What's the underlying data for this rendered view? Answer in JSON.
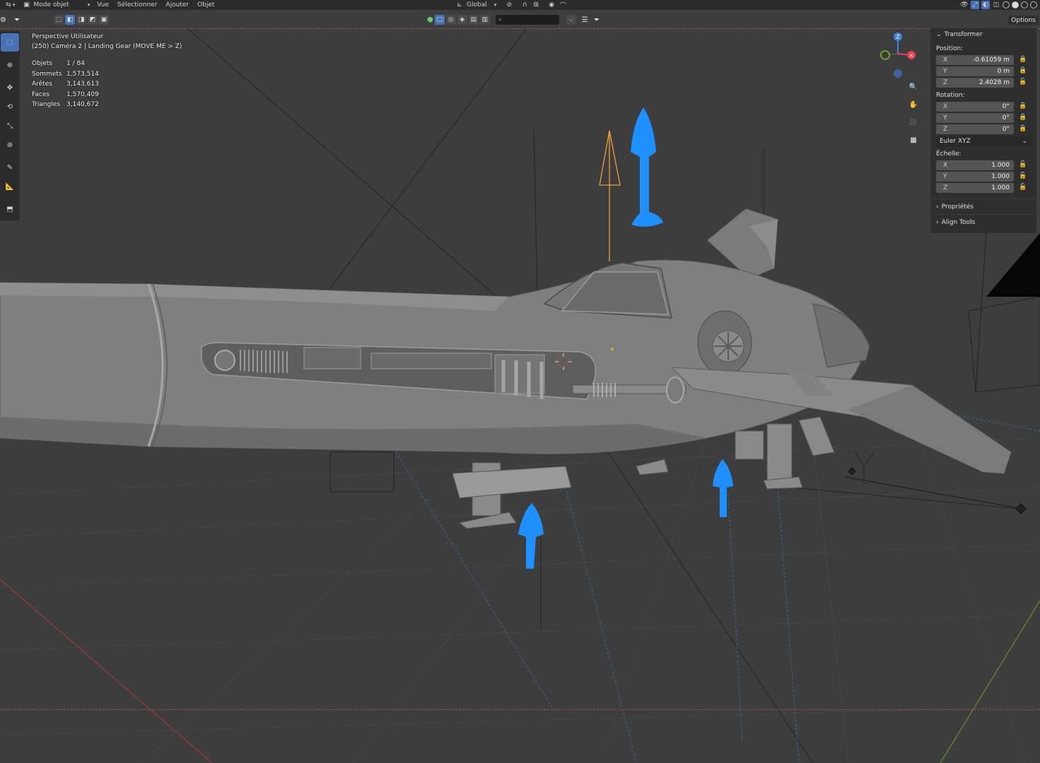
{
  "header": {
    "mode_label": "Mode objet",
    "menus": [
      "Vue",
      "Sélectionner",
      "Ajouter",
      "Objet"
    ],
    "orientation_label": "Global",
    "options_label": "Options"
  },
  "overlay": {
    "view_name": "Perspective Utilisateur",
    "object_info": "(250) Caméra 2 | Landing Gear (MOVE ME > Z)",
    "stats": [
      {
        "label": "Objets",
        "value": "1 / 84"
      },
      {
        "label": "Sommets",
        "value": "1,573,514"
      },
      {
        "label": "Arêtes",
        "value": "3,143,613"
      },
      {
        "label": "Faces",
        "value": "1,570,409"
      },
      {
        "label": "Triangles",
        "value": "3,140,672"
      }
    ]
  },
  "gizmo": {
    "z_label": "Z",
    "x_color": "#e8424f",
    "y_color": "#6ba32c",
    "z_color": "#3c84dc"
  },
  "npanel": {
    "transform_title": "Transformer",
    "position_label": "Position:",
    "position": [
      {
        "axis": "X",
        "value": "-0.61059 m",
        "locked": true
      },
      {
        "axis": "Y",
        "value": "0 m",
        "locked": true
      },
      {
        "axis": "Z",
        "value": "2.4028 m",
        "locked": false
      }
    ],
    "rotation_label": "Rotation:",
    "rotation": [
      {
        "axis": "X",
        "value": "0°",
        "locked": true
      },
      {
        "axis": "Y",
        "value": "0°",
        "locked": true
      },
      {
        "axis": "Z",
        "value": "0°",
        "locked": true
      }
    ],
    "rotation_mode": "Euler XYZ",
    "scale_label": "Échelle:",
    "scale": [
      {
        "axis": "X",
        "value": "1.000",
        "locked": false
      },
      {
        "axis": "Y",
        "value": "1.000",
        "locked": false
      },
      {
        "axis": "Z",
        "value": "1.000",
        "locked": false
      }
    ],
    "properties_label": "Propriétés",
    "align_label": "Align Tools"
  },
  "colors": {
    "accent": "#4772b3",
    "viewport_bg": "#3c3c3c",
    "annotation_arrow": "#1e90ff",
    "camera": "#f0a030"
  }
}
